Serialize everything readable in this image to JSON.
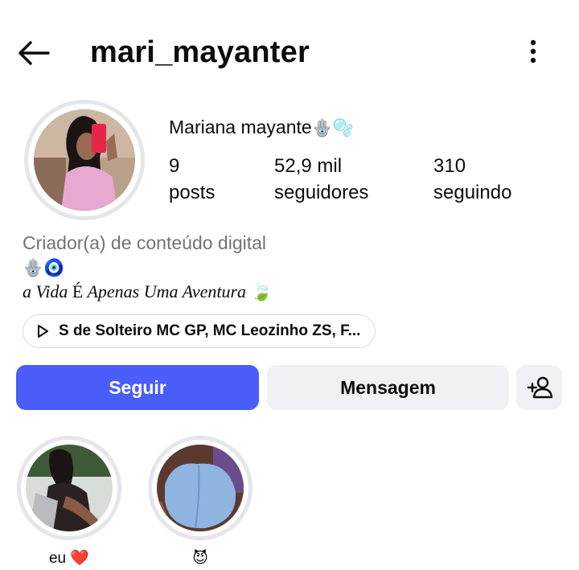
{
  "header": {
    "username": "mari_mayanter",
    "back_icon": "arrow-left-icon",
    "more_icon": "vertical-dots-icon"
  },
  "profile": {
    "full_name": "Mariana mayante",
    "name_emoji": "🪬🫧",
    "stats": [
      {
        "value": "9",
        "label": "posts"
      },
      {
        "value": "52,9 mil",
        "label": "seguidores"
      },
      {
        "value": "310",
        "label": "seguindo"
      }
    ],
    "category": "Criador(a) de conteúdo digital",
    "bio_emoji": "🪬🧿",
    "bio_text_before": "a Vida ",
    "bio_text_upright": "É",
    "bio_text_after": " Apenas Uma Aventura ",
    "bio_text_emoji": "🍃",
    "music": "S de Solteiro MC GP, MC Leozinho ZS, F..."
  },
  "actions": {
    "follow_label": "Seguir",
    "message_label": "Mensagem",
    "add_person_icon": "add-person-icon"
  },
  "highlights": [
    {
      "label": "eu",
      "emoji": "❤️"
    },
    {
      "label": "",
      "emoji": "😈"
    }
  ],
  "colors": {
    "accent": "#4a5df9",
    "button_secondary": "#eff1f4",
    "muted_text": "#737373",
    "ring": "#e4e6ea"
  }
}
